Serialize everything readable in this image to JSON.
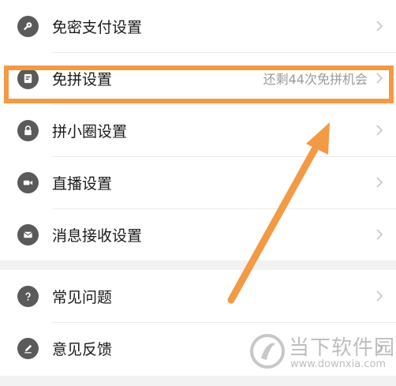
{
  "settings": {
    "section1": [
      {
        "label": "免密支付设置",
        "icon": "key-icon",
        "extra": ""
      },
      {
        "label": "免拼设置",
        "icon": "card-icon",
        "extra": "还剩44次免拼机会"
      },
      {
        "label": "拼小圈设置",
        "icon": "lock-icon",
        "extra": ""
      },
      {
        "label": "直播设置",
        "icon": "video-camera-icon",
        "extra": ""
      },
      {
        "label": "消息接收设置",
        "icon": "mail-icon",
        "extra": ""
      }
    ],
    "section2": [
      {
        "label": "常见问题",
        "icon": "question-icon",
        "extra": ""
      },
      {
        "label": "意见反馈",
        "icon": "pencil-icon",
        "extra": ""
      }
    ]
  },
  "annotation": {
    "highlight_color": "#f39a45",
    "arrow_color": "#f39a45"
  },
  "watermark": {
    "title": "当下软件园",
    "url": "www.downxia.com"
  }
}
